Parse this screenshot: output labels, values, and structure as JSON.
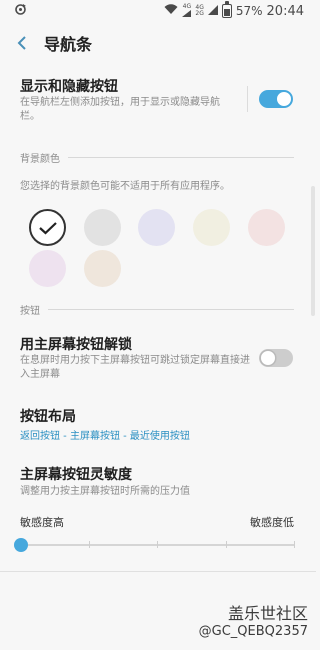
{
  "status": {
    "battery": "57%",
    "time": "20:44",
    "net1": "4G",
    "net2_top": "4G",
    "net2_bottom": "2G"
  },
  "header": {
    "title": "导航条"
  },
  "toggle_nav": {
    "title": "显示和隐藏按钮",
    "desc": "在导航栏左侧添加按钮，用于显示或隐藏导航栏。",
    "state": "on"
  },
  "background": {
    "section": "背景颜色",
    "note": "您选择的背景颜色可能不适用于所有应用程序。",
    "colors": [
      "#ffffff",
      "#e2e2e2",
      "#e3e2f2",
      "#f1efe1",
      "#f3e2e2",
      "#eee2ef",
      "#efe6dc"
    ],
    "selected_index": 0
  },
  "buttons_section": {
    "section": "按钮"
  },
  "unlock": {
    "title": "用主屏幕按钮解锁",
    "desc": "在息屏时用力按下主屏幕按钮可跳过锁定屏幕直接进入主屏幕",
    "state": "off"
  },
  "layout": {
    "title": "按钮布局",
    "value": "返回按钮 - 主屏幕按钮 - 最近使用按钮"
  },
  "sensitivity": {
    "title": "主屏幕按钮灵敏度",
    "desc": "调整用力按主屏幕按钮时所需的压力值",
    "high_label": "敏感度高",
    "low_label": "敏感度低",
    "level": 0,
    "steps": 5
  },
  "watermark": {
    "brand": "盖乐世社区",
    "user": "@GC_QEBQ2357"
  }
}
